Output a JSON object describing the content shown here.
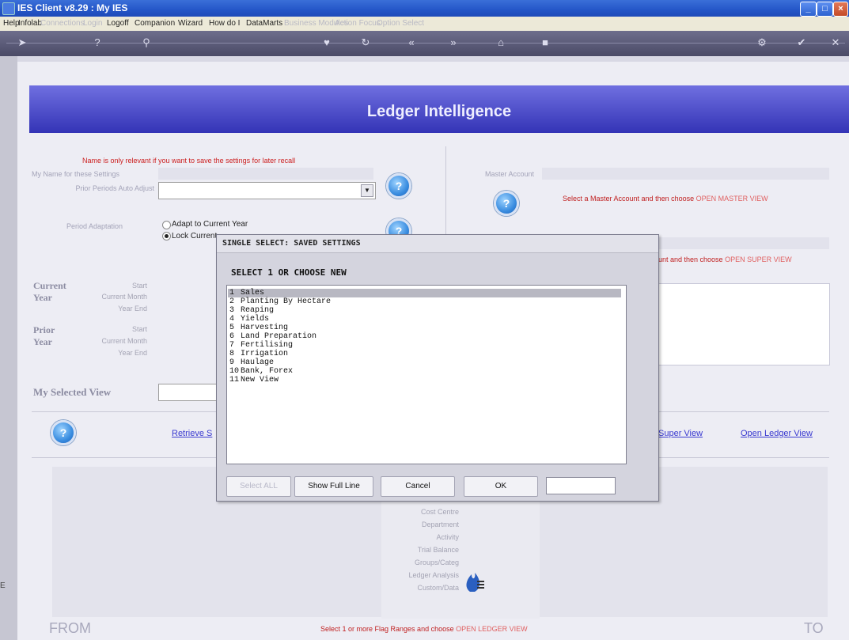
{
  "window": {
    "title": "IES Client v8.29 : My IES",
    "min": "_",
    "max": "□",
    "close": "×"
  },
  "menu": {
    "items": [
      "Help",
      "Infolab",
      "Connections",
      "Login",
      "Logoff",
      "Companion",
      "Wizard",
      "How do I",
      "DataMarts",
      "Business Modules",
      "Action Focus",
      "Option Select"
    ],
    "dim_index": [
      2,
      3,
      9,
      10,
      11
    ]
  },
  "toolbar": {
    "icons": [
      {
        "name": "arrow-right-icon",
        "glyph": "➤"
      },
      {
        "name": "help-icon",
        "glyph": "?"
      },
      {
        "name": "search-icon",
        "glyph": "⚲"
      },
      {
        "name": "heart-icon",
        "glyph": "♥"
      },
      {
        "name": "refresh-icon",
        "glyph": "↻"
      },
      {
        "name": "rewind-icon",
        "glyph": "«"
      },
      {
        "name": "forward-icon",
        "glyph": "»"
      },
      {
        "name": "home-icon",
        "glyph": "⌂"
      },
      {
        "name": "stop-icon",
        "glyph": "■"
      },
      {
        "name": "settings-icon",
        "glyph": "⚙"
      },
      {
        "name": "check-icon",
        "glyph": "✔"
      },
      {
        "name": "close-icon",
        "glyph": "✕"
      }
    ]
  },
  "page": {
    "title": "Ledger Intelligence",
    "settings_note": "Name is only relevant if you want to save the settings for later recall",
    "my_name_label": "My Name for these Settings",
    "prior_periods_label": "Prior Periods Auto Adjust",
    "period_adaptation_label": "Period Adaptation",
    "radio_adjust": "Adapt to Current Year",
    "radio_lock": "Lock Current",
    "master_account_label": "Master Account",
    "master_hint": "Select a Master Account and then choose",
    "master_hint_action": "OPEN MASTER VIEW",
    "super_hint": "unt and then choose",
    "super_hint_action": "OPEN SUPER VIEW",
    "current": "Current",
    "year": "Year",
    "prior": "Prior",
    "start": "Start",
    "current_month": "Current Month",
    "year_end": "Year End",
    "my_selected_view": "My Selected View",
    "retrieve_link": "Retrieve S",
    "super_view_link": "Super View",
    "open_ledger_link": "Open Ledger View",
    "help_glyph": "?",
    "flag_labels": [
      "Cost Centre",
      "Department",
      "Activity",
      "Trial Balance",
      "Groups/Categ",
      "Ledger Analysis",
      "Custom/Data"
    ],
    "from": "FROM",
    "to": "TO",
    "bottom_hint": "Select 1 or more Flag Ranges and choose",
    "bottom_hint_action": "OPEN LEDGER VIEW"
  },
  "dialog": {
    "title": "SINGLE SELECT: SAVED SETTINGS",
    "heading": "SELECT 1 OR CHOOSE NEW",
    "options": [
      {
        "num": "1",
        "label": "Sales",
        "selected": true
      },
      {
        "num": "2",
        "label": "Planting By Hectare"
      },
      {
        "num": "3",
        "label": "Reaping"
      },
      {
        "num": "4",
        "label": "Yields"
      },
      {
        "num": "5",
        "label": "Harvesting"
      },
      {
        "num": "6",
        "label": "Land Preparation"
      },
      {
        "num": "7",
        "label": "Fertilising"
      },
      {
        "num": "8",
        "label": "Irrigation"
      },
      {
        "num": "9",
        "label": "Haulage"
      },
      {
        "num": "10",
        "label": "Bank, Forex"
      },
      {
        "num": "11",
        "label": "New View"
      }
    ],
    "btn_select_all": "Select ALL",
    "btn_show_full_line": "Show Full Line",
    "btn_cancel": "Cancel",
    "btn_ok": "OK",
    "search_value": ""
  }
}
